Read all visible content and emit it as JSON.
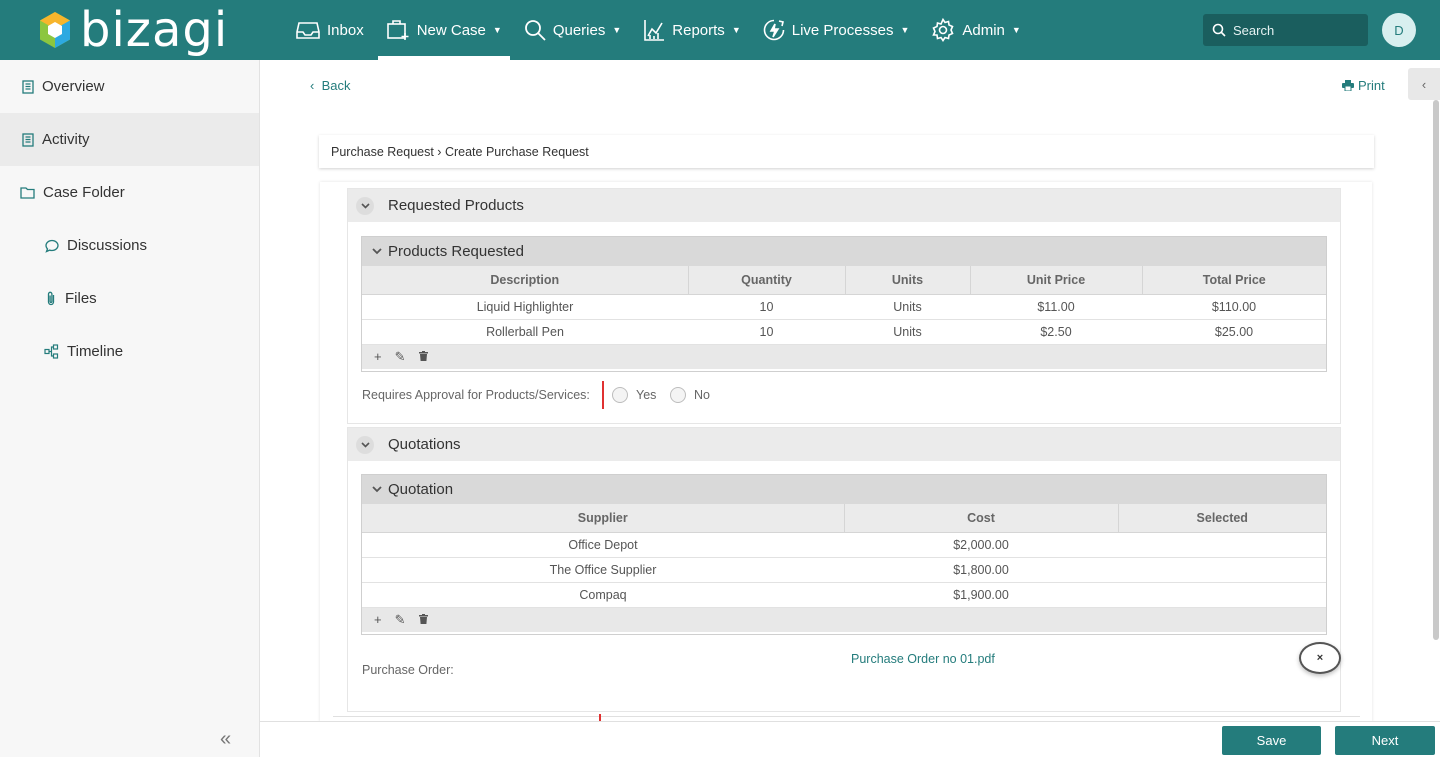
{
  "app": {
    "logo_text": "bizagi",
    "brand_color": "#247C7C"
  },
  "nav": {
    "items": [
      {
        "label": "Inbox",
        "icon": "inbox-icon"
      },
      {
        "label": "New Case",
        "icon": "new-case-icon"
      },
      {
        "label": "Queries",
        "icon": "search-icon"
      },
      {
        "label": "Reports",
        "icon": "chart-icon"
      },
      {
        "label": "Live Processes",
        "icon": "lightning-icon"
      },
      {
        "label": "Admin",
        "icon": "gear-icon"
      }
    ],
    "search_placeholder": "Search",
    "avatar_initial": "D"
  },
  "sidebar": {
    "items": [
      {
        "label": "Overview",
        "icon": "document-icon"
      },
      {
        "label": "Activity",
        "icon": "document-icon"
      },
      {
        "label": "Case Folder",
        "icon": "folder-icon"
      },
      {
        "label": "Discussions",
        "icon": "chat-icon"
      },
      {
        "label": "Files",
        "icon": "paperclip-icon"
      },
      {
        "label": "Timeline",
        "icon": "timeline-icon"
      }
    ],
    "collapse_glyph": "«"
  },
  "page": {
    "back_label": "Back",
    "print_label": "Print",
    "breadcrumb": "Purchase Request › Create Purchase Request"
  },
  "requested_products": {
    "group_title": "Requested Products",
    "grid_title": "Products Requested",
    "columns": [
      "Description",
      "Quantity",
      "Units",
      "Unit Price",
      "Total Price"
    ],
    "rows": [
      [
        "Liquid Highlighter",
        "10",
        "Units",
        "$11.00",
        "$110.00"
      ],
      [
        "Rollerball Pen",
        "10",
        "Units",
        "$2.50",
        "$25.00"
      ]
    ],
    "approval_label": "Requires Approval for Products/Services:",
    "approval_options": [
      "Yes",
      "No"
    ]
  },
  "quotations": {
    "group_title": "Quotations",
    "grid_title": "Quotation",
    "columns": [
      "Supplier",
      "Cost",
      "Selected"
    ],
    "rows": [
      [
        "Office Depot",
        "$2,000.00",
        ""
      ],
      [
        "The Office Supplier",
        "$1,800.00",
        ""
      ],
      [
        "Compaq",
        "$1,900.00",
        ""
      ]
    ],
    "purchase_order_label": "Purchase Order:",
    "purchase_order_file": "Purchase Order no 01.pdf",
    "delete_glyph": "×"
  },
  "grid_tools": {
    "add": "+",
    "edit": "✎",
    "delete": "🗑"
  },
  "actions": {
    "save_label": "Save",
    "next_label": "Next"
  }
}
